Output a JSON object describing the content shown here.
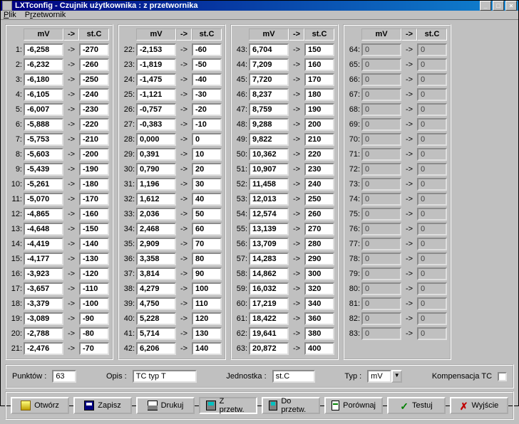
{
  "window": {
    "title": "LXTconfig - Czujnik użytkownika : z przetwornika"
  },
  "menu": {
    "file": "Plik",
    "conv": "Przetwornik"
  },
  "headers": {
    "mv": "mV",
    "arrow": "->",
    "stc": "st.C"
  },
  "rows": [
    {
      "i": 1,
      "mv": "-6,258",
      "st": "-270"
    },
    {
      "i": 2,
      "mv": "-6,232",
      "st": "-260"
    },
    {
      "i": 3,
      "mv": "-6,180",
      "st": "-250"
    },
    {
      "i": 4,
      "mv": "-6,105",
      "st": "-240"
    },
    {
      "i": 5,
      "mv": "-6,007",
      "st": "-230"
    },
    {
      "i": 6,
      "mv": "-5,888",
      "st": "-220"
    },
    {
      "i": 7,
      "mv": "-5,753",
      "st": "-210"
    },
    {
      "i": 8,
      "mv": "-5,603",
      "st": "-200"
    },
    {
      "i": 9,
      "mv": "-5,439",
      "st": "-190"
    },
    {
      "i": 10,
      "mv": "-5,261",
      "st": "-180"
    },
    {
      "i": 11,
      "mv": "-5,070",
      "st": "-170"
    },
    {
      "i": 12,
      "mv": "-4,865",
      "st": "-160"
    },
    {
      "i": 13,
      "mv": "-4,648",
      "st": "-150"
    },
    {
      "i": 14,
      "mv": "-4,419",
      "st": "-140"
    },
    {
      "i": 15,
      "mv": "-4,177",
      "st": "-130"
    },
    {
      "i": 16,
      "mv": "-3,923",
      "st": "-120"
    },
    {
      "i": 17,
      "mv": "-3,657",
      "st": "-110"
    },
    {
      "i": 18,
      "mv": "-3,379",
      "st": "-100"
    },
    {
      "i": 19,
      "mv": "-3,089",
      "st": "-90"
    },
    {
      "i": 20,
      "mv": "-2,788",
      "st": "-80"
    },
    {
      "i": 21,
      "mv": "-2,476",
      "st": "-70"
    },
    {
      "i": 22,
      "mv": "-2,153",
      "st": "-60"
    },
    {
      "i": 23,
      "mv": "-1,819",
      "st": "-50"
    },
    {
      "i": 24,
      "mv": "-1,475",
      "st": "-40"
    },
    {
      "i": 25,
      "mv": "-1,121",
      "st": "-30"
    },
    {
      "i": 26,
      "mv": "-0,757",
      "st": "-20"
    },
    {
      "i": 27,
      "mv": "-0,383",
      "st": "-10"
    },
    {
      "i": 28,
      "mv": "0,000",
      "st": "0"
    },
    {
      "i": 29,
      "mv": "0,391",
      "st": "10"
    },
    {
      "i": 30,
      "mv": "0,790",
      "st": "20"
    },
    {
      "i": 31,
      "mv": "1,196",
      "st": "30"
    },
    {
      "i": 32,
      "mv": "1,612",
      "st": "40"
    },
    {
      "i": 33,
      "mv": "2,036",
      "st": "50"
    },
    {
      "i": 34,
      "mv": "2,468",
      "st": "60"
    },
    {
      "i": 35,
      "mv": "2,909",
      "st": "70"
    },
    {
      "i": 36,
      "mv": "3,358",
      "st": "80"
    },
    {
      "i": 37,
      "mv": "3,814",
      "st": "90"
    },
    {
      "i": 38,
      "mv": "4,279",
      "st": "100"
    },
    {
      "i": 39,
      "mv": "4,750",
      "st": "110"
    },
    {
      "i": 40,
      "mv": "5,228",
      "st": "120"
    },
    {
      "i": 41,
      "mv": "5,714",
      "st": "130"
    },
    {
      "i": 42,
      "mv": "6,206",
      "st": "140"
    },
    {
      "i": 43,
      "mv": "6,704",
      "st": "150"
    },
    {
      "i": 44,
      "mv": "7,209",
      "st": "160"
    },
    {
      "i": 45,
      "mv": "7,720",
      "st": "170"
    },
    {
      "i": 46,
      "mv": "8,237",
      "st": "180"
    },
    {
      "i": 47,
      "mv": "8,759",
      "st": "190"
    },
    {
      "i": 48,
      "mv": "9,288",
      "st": "200"
    },
    {
      "i": 49,
      "mv": "9,822",
      "st": "210"
    },
    {
      "i": 50,
      "mv": "10,362",
      "st": "220"
    },
    {
      "i": 51,
      "mv": "10,907",
      "st": "230"
    },
    {
      "i": 52,
      "mv": "11,458",
      "st": "240"
    },
    {
      "i": 53,
      "mv": "12,013",
      "st": "250"
    },
    {
      "i": 54,
      "mv": "12,574",
      "st": "260"
    },
    {
      "i": 55,
      "mv": "13,139",
      "st": "270"
    },
    {
      "i": 56,
      "mv": "13,709",
      "st": "280"
    },
    {
      "i": 57,
      "mv": "14,283",
      "st": "290"
    },
    {
      "i": 58,
      "mv": "14,862",
      "st": "300"
    },
    {
      "i": 59,
      "mv": "16,032",
      "st": "320"
    },
    {
      "i": 60,
      "mv": "17,219",
      "st": "340"
    },
    {
      "i": 61,
      "mv": "18,422",
      "st": "360"
    },
    {
      "i": 62,
      "mv": "19,641",
      "st": "380"
    },
    {
      "i": 63,
      "mv": "20,872",
      "st": "400"
    }
  ],
  "disabled_rows": [
    64,
    65,
    66,
    67,
    68,
    69,
    70,
    71,
    72,
    73,
    74,
    75,
    76,
    77,
    78,
    79,
    80,
    81,
    82,
    83
  ],
  "disabled_val": "0",
  "bottom": {
    "points_label": "Punktów :",
    "points": "63",
    "desc_label": "Opis :",
    "desc": "TC typ T",
    "unit_label": "Jednostka :",
    "unit": "st.C",
    "type_label": "Typ :",
    "type": "mV",
    "comp_label": "Kompensacja TC"
  },
  "buttons": {
    "open": "Otwórz",
    "save": "Zapisz",
    "print": "Drukuj",
    "from": "Z przetw.",
    "to": "Do przetw.",
    "compare": "Porównaj",
    "test": "Testuj",
    "exit": "Wyjście"
  }
}
